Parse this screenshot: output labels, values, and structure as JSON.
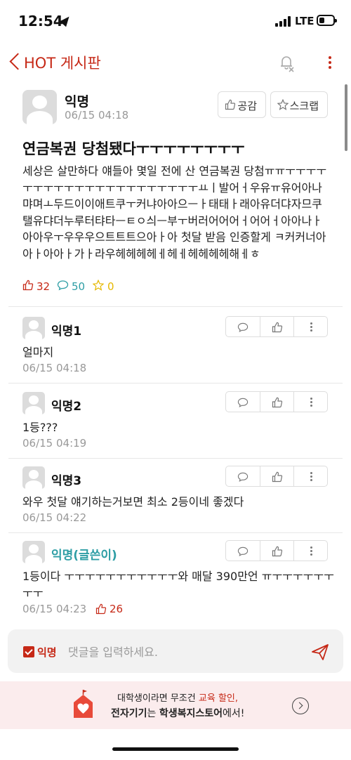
{
  "status_bar": {
    "time": "12:54",
    "network": "LTE",
    "battery_level": 0.4
  },
  "header": {
    "title": "HOT 게시판",
    "back_icon": "chevron-left-icon",
    "notification_icon": "bell-off-icon",
    "more_icon": "more-vertical-icon",
    "accent_color": "#c62917"
  },
  "post": {
    "author": "익명",
    "date": "06/15 04:18",
    "like_button_label": "공감",
    "scrap_button_label": "스크랩",
    "title": "연금복권 당첨됐다ㅜㅜㅜㅜㅜㅜㅜㅜ",
    "body": "세상은 살만하다 얘들아 몇일 전에 산 연금복권 당첨ㅠㅠㅜㅜㅜㅜㅜㅜㅜㅜㅜㅜㅜㅜㅜㅜㅜㅜㅜㅜㅜㅜㅜㅛㅣ발어ㅓ우유ㅠ유어아나먀며ㅗ두드이이애트쿠ㅜ커냐아아으ㅡㅏ태태ㅏ래아유더댜자므쿠탤유댜더누루터탸타ㅡㅌㅇ싀ㅡ부ㅜ버러어어어ㅓ어어ㅓ아아나ㅏ아아우ㅜ우우우으트트트으아ㅏ아 첫달 받음 인증할게 ㅋ커커너아아ㅏ아아ㅏ가ㅏ라우헤헤헤헤ㅔ헤ㅔ헤헤헤헤해ㅔㅎ",
    "likes": "32",
    "comments": "50",
    "scraps": "0"
  },
  "comments": [
    {
      "name": "익명1",
      "text": "얼마지",
      "date": "06/15 04:18",
      "is_author": false,
      "likes": ""
    },
    {
      "name": "익명2",
      "text": "1등???",
      "date": "06/15 04:19",
      "is_author": false,
      "likes": ""
    },
    {
      "name": "익명3",
      "text": "와우 첫달 얘기하는거보면 최소 2등이네 좋겠다",
      "date": "06/15 04:22",
      "is_author": false,
      "likes": ""
    },
    {
      "name": "익명(글쓴이)",
      "text": "1등이다 ㅜㅜㅜㅜㅜㅜㅜㅜㅜㅜㅜ와 매달 390만언 ㅠㅜㅜㅜㅜㅜㅜㅜㅜ",
      "date": "06/15 04:23",
      "is_author": true,
      "likes": "26"
    }
  ],
  "comment_input": {
    "anonymous_label": "익명",
    "anonymous_checked": true,
    "placeholder": "댓글을 입력하세요.",
    "send_icon": "send-icon"
  },
  "banner": {
    "line1_prefix": "대학생이라면 무조건 ",
    "line1_highlight": "교육 할인,",
    "line2_part1": "전자기기",
    "line2_part2": "는 ",
    "line2_part3": "학생복지스토어",
    "line2_part4": "에서!",
    "icon": "store-icon"
  },
  "colors": {
    "accent": "#c62917",
    "comment_count": "#2e9ea5",
    "scrap": "#e6b800",
    "op_name": "#2e9ea5"
  }
}
